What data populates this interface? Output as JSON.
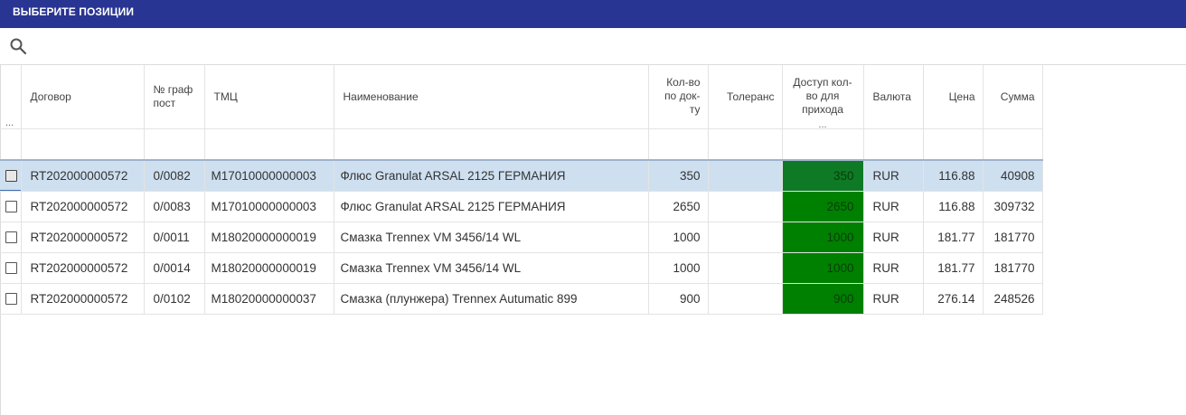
{
  "dialog": {
    "title": "ВЫБЕРИТЕ ПОЗИЦИИ"
  },
  "search": {
    "icon": "search-icon",
    "value": "",
    "placeholder": ""
  },
  "table": {
    "select_column_menu": "...",
    "available_column_menu": "...",
    "columns": {
      "contract": "Договор",
      "schedule_line": "№ граф пост",
      "tmc": "ТМЦ",
      "name": "Наименование",
      "qty_doc": "Кол-во по док-ту",
      "tolerance": "Толеранс",
      "available_qty": "Доступ кол-во для прихода",
      "currency": "Валюта",
      "price": "Цена",
      "sum": "Сумма"
    },
    "rows": [
      {
        "checked": false,
        "selected": true,
        "contract": "RT202000000572",
        "schedule_line": "0/0082",
        "tmc": "M17010000000003",
        "name": "Флюс Granulat ARSAL 2125 ГЕРМАНИЯ",
        "qty_doc": "350",
        "tolerance": "",
        "available_qty": "350",
        "currency": "RUR",
        "price": "116.88",
        "sum": "40908"
      },
      {
        "checked": false,
        "selected": false,
        "contract": "RT202000000572",
        "schedule_line": "0/0083",
        "tmc": "M17010000000003",
        "name": "Флюс Granulat ARSAL 2125 ГЕРМАНИЯ",
        "qty_doc": "2650",
        "tolerance": "",
        "available_qty": "2650",
        "currency": "RUR",
        "price": "116.88",
        "sum": "309732"
      },
      {
        "checked": false,
        "selected": false,
        "contract": "RT202000000572",
        "schedule_line": "0/0011",
        "tmc": "M18020000000019",
        "name": "Смазка Trennex VM 3456/14 WL",
        "qty_doc": "1000",
        "tolerance": "",
        "available_qty": "1000",
        "currency": "RUR",
        "price": "181.77",
        "sum": "181770"
      },
      {
        "checked": false,
        "selected": false,
        "contract": "RT202000000572",
        "schedule_line": "0/0014",
        "tmc": "M18020000000019",
        "name": "Смазка Trennex VM 3456/14 WL",
        "qty_doc": "1000",
        "tolerance": "",
        "available_qty": "1000",
        "currency": "RUR",
        "price": "181.77",
        "sum": "181770"
      },
      {
        "checked": false,
        "selected": false,
        "contract": "RT202000000572",
        "schedule_line": "0/0102",
        "tmc": "M18020000000037",
        "name": "Смазка (плунжера) Trennex Autumatic 899",
        "qty_doc": "900",
        "tolerance": "",
        "available_qty": "900",
        "currency": "RUR",
        "price": "276.14",
        "sum": "248526"
      }
    ]
  },
  "colors": {
    "titlebar": "#283593",
    "available_cell": "#008000",
    "selected_row": "#cedff0"
  }
}
